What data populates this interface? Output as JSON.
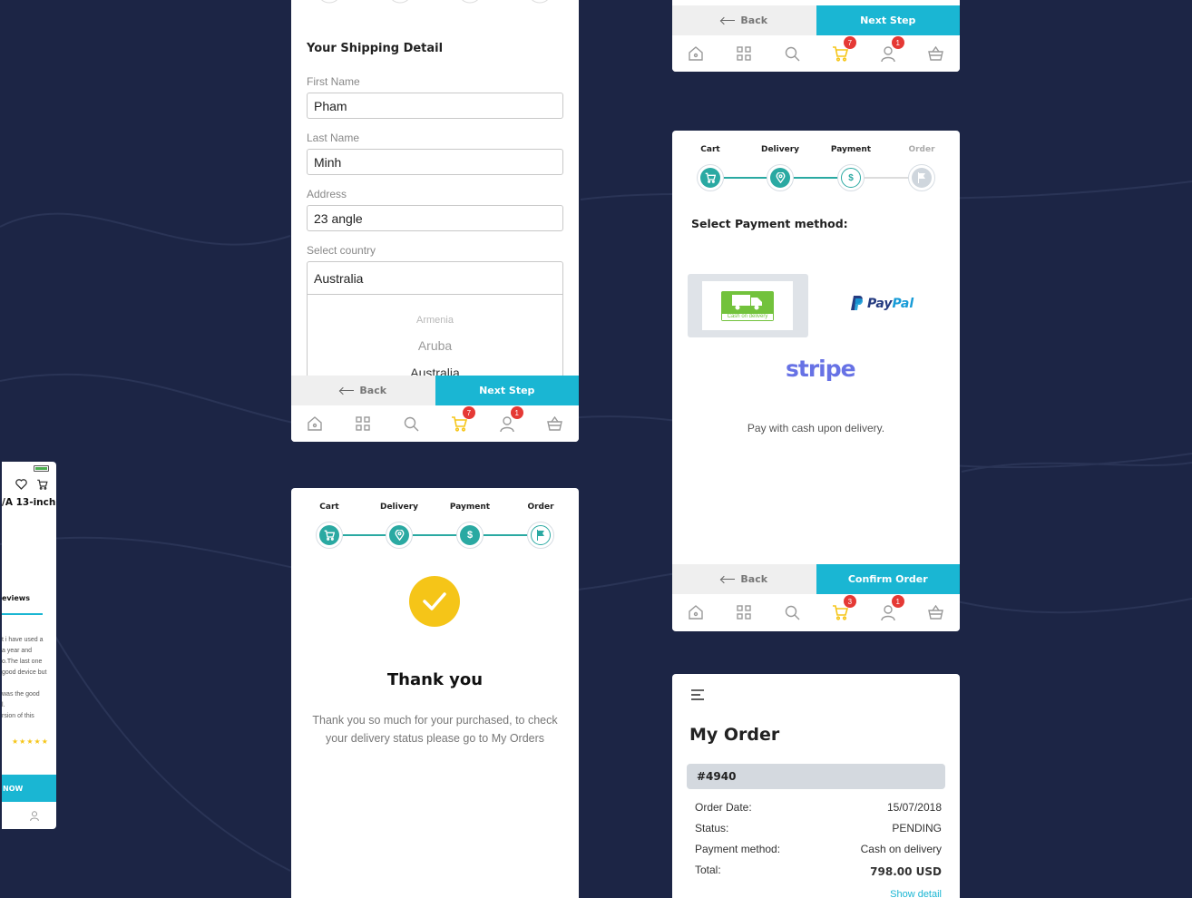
{
  "colors": {
    "background": "#1c2545",
    "accent": "#1ab6d3",
    "step_teal": "#2aa9a2",
    "badge_red": "#e53935",
    "check_yellow": "#f5c518",
    "paypal_dark": "#253b80",
    "paypal_light": "#179bd7",
    "stripe": "#6772e5"
  },
  "common": {
    "back_label": "Back",
    "next_label": "Next Step",
    "confirm_label": "Confirm Order"
  },
  "tabbar": {
    "icons": [
      "home-icon",
      "grid-icon",
      "search-icon",
      "cart-icon",
      "user-icon",
      "basket-icon"
    ]
  },
  "screen_top_right": {
    "cart_badge": "7",
    "user_badge": "1"
  },
  "shipping": {
    "title": "Your Shipping Detail",
    "first_name_label": "First Name",
    "first_name_value": "Pham",
    "last_name_label": "Last Name",
    "last_name_value": "Minh",
    "address_label": "Address",
    "address_value": "23 angle",
    "country_label": "Select country",
    "country_value": "Australia",
    "picker_options": [
      "Armenia",
      "Aruba",
      "Australia"
    ],
    "cart_badge": "7",
    "user_badge": "1"
  },
  "steps": {
    "cart": "Cart",
    "delivery": "Delivery",
    "payment": "Payment",
    "order": "Order"
  },
  "payment": {
    "title": "Select Payment method:",
    "cod_label": "Cash on delivery",
    "paypal_text_1": "Pay",
    "paypal_text_2": "Pal",
    "stripe_text": "stripe",
    "description": "Pay with cash upon delivery.",
    "cart_badge": "3",
    "user_badge": "1"
  },
  "thanks": {
    "title": "Thank you",
    "message_line1": "Thank you so much for your purchased, to check",
    "message_line2": "your delivery status please go to My Orders"
  },
  "order": {
    "title": "My Order",
    "number": "#4940",
    "rows": [
      {
        "label": "Order Date:",
        "value": "15/07/2018"
      },
      {
        "label": "Status:",
        "value": "PENDING"
      },
      {
        "label": "Payment method:",
        "value": "Cash on delivery"
      },
      {
        "label": "Total:",
        "value": "798.00 USD"
      }
    ],
    "show_detail": "Show detail"
  },
  "product": {
    "title_partial": "/A 13-inch",
    "reviews_partial": "eviews",
    "review_lines": [
      "t i have used a",
      "a year and",
      "o.The last one",
      "good device but",
      "",
      "was the good",
      "l.",
      "rsion of this"
    ],
    "stars": "★★★★★",
    "buy_partial": "NOW"
  }
}
